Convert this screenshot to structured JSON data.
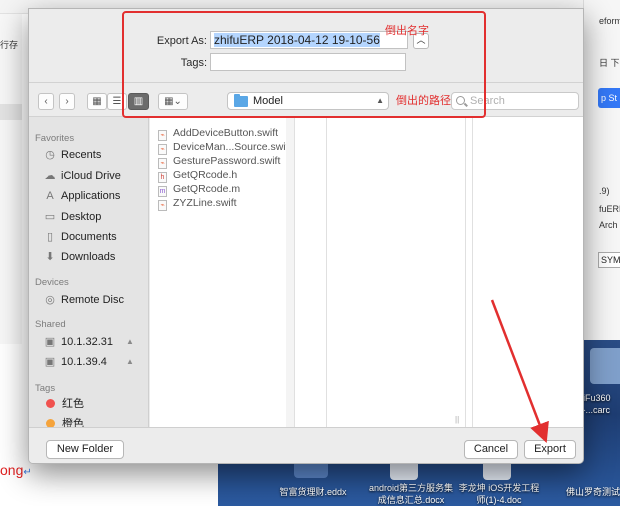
{
  "background": {
    "left_text": "行存",
    "right_texts": [
      "eform",
      "日 下午",
      "p St",
      ".9)",
      "fuERP",
      "Arch",
      "SYM"
    ],
    "word_text": "ong",
    "word_mark": "↵",
    "desktop_items": [
      "智富货理财.eddx",
      "android第三方服务集成信息汇总.docx",
      "李龙坤 iOS开发工程师(1)-4.doc",
      "佛山罗奇测试",
      "hiFu360\ns-...carc"
    ]
  },
  "dialog": {
    "export_as_label": "Export As:",
    "export_as_value": "zhifuERP 2018-04-12 19-10-56",
    "tags_label": "Tags:",
    "tags_value": "",
    "disclosure_icon": "chevron-up",
    "location": "Model",
    "search_placeholder": "Search",
    "sidebar": {
      "favorites_header": "Favorites",
      "favorites": [
        "Recents",
        "iCloud Drive",
        "Applications",
        "Desktop",
        "Documents",
        "Downloads"
      ],
      "devices_header": "Devices",
      "devices": [
        "Remote Disc"
      ],
      "shared_header": "Shared",
      "shared": [
        "10.1.32.31",
        "10.1.39.4"
      ],
      "tags_header": "Tags",
      "tags": [
        {
          "label": "红色",
          "color": "#f0524f"
        },
        {
          "label": "橙色",
          "color": "#f5a33b"
        }
      ]
    },
    "files": [
      {
        "name": "AddDeviceButton.swift",
        "kind": "swift"
      },
      {
        "name": "DeviceMan...Source.swift",
        "kind": "swift"
      },
      {
        "name": "GesturePassword.swift",
        "kind": "swift"
      },
      {
        "name": "GetQRcode.h",
        "kind": "h"
      },
      {
        "name": "GetQRcode.m",
        "kind": "m"
      },
      {
        "name": "ZYZLine.swift",
        "kind": "swift"
      }
    ],
    "new_folder_label": "New Folder",
    "cancel_label": "Cancel",
    "export_label": "Export"
  },
  "annotations": {
    "name_note": "倒出名字",
    "path_note": "倒出的路径",
    "color": "#e22f2f"
  }
}
